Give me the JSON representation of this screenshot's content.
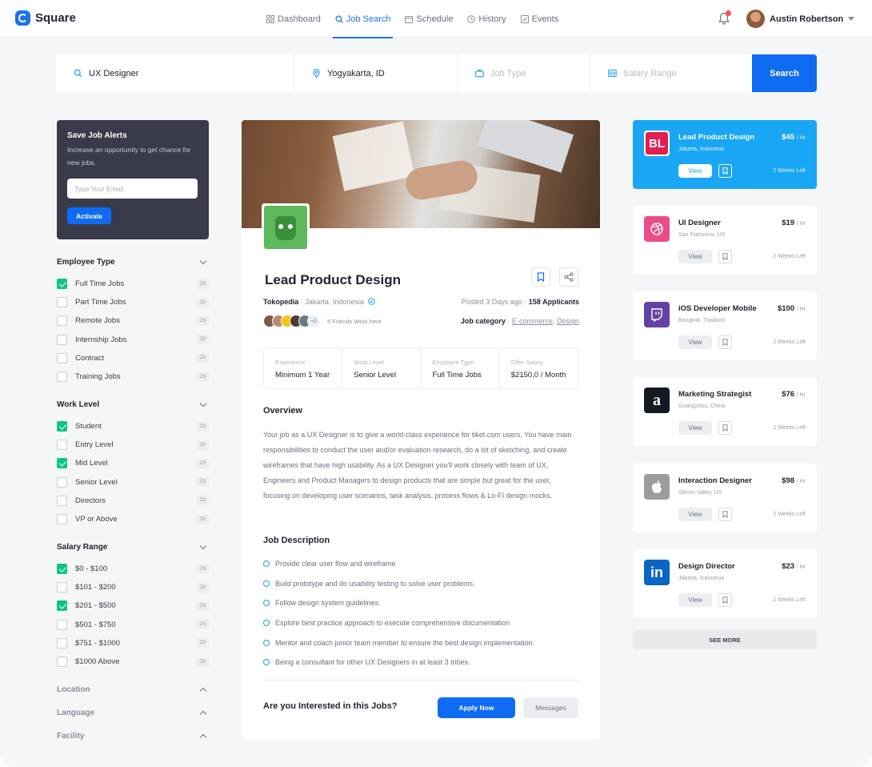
{
  "brand": {
    "name": "Square",
    "accent": "#0f6cf2"
  },
  "nav": {
    "items": [
      {
        "label": "Dashboard",
        "icon": "grid-icon"
      },
      {
        "label": "Job Search",
        "icon": "search-icon",
        "active": true
      },
      {
        "label": "Schedule",
        "icon": "calendar-icon"
      },
      {
        "label": "History",
        "icon": "clock-icon"
      },
      {
        "label": "Events",
        "icon": "checkbox-icon"
      }
    ],
    "user": {
      "name": "Austin Robertson"
    }
  },
  "search": {
    "keyword": "UX Designer",
    "location": "Yogyakarta, ID",
    "job_type_placeholder": "Job Type",
    "salary_placeholder": "Salary Range",
    "button": "Search"
  },
  "alerts": {
    "title": "Save Job Alerts",
    "desc": "Increase an opportunity to get chance for new jobs.",
    "email_placeholder": "Type Your Email",
    "button": "Activate"
  },
  "filters": {
    "employee_type": {
      "title": "Employee Type",
      "options": [
        {
          "label": "Full Time Jobs",
          "count": "23",
          "checked": true
        },
        {
          "label": "Part Time Jobs",
          "count": "23",
          "checked": false
        },
        {
          "label": "Remote Jobs",
          "count": "23",
          "checked": false
        },
        {
          "label": "Internship Jobs",
          "count": "23",
          "checked": false
        },
        {
          "label": "Contract",
          "count": "23",
          "checked": false
        },
        {
          "label": "Training Jobs",
          "count": "23",
          "checked": false
        }
      ]
    },
    "work_level": {
      "title": "Work Level",
      "options": [
        {
          "label": "Student",
          "count": "23",
          "checked": true
        },
        {
          "label": "Entry Level",
          "count": "23",
          "checked": false
        },
        {
          "label": "Mid Level",
          "count": "23",
          "checked": true
        },
        {
          "label": "Senior Level",
          "count": "23",
          "checked": false
        },
        {
          "label": "Directors",
          "count": "23",
          "checked": false
        },
        {
          "label": "VP or Above",
          "count": "23",
          "checked": false
        }
      ]
    },
    "salary_range": {
      "title": "Salary Range",
      "options": [
        {
          "label": "$0 - $100",
          "count": "23",
          "checked": true
        },
        {
          "label": "$101 - $200",
          "count": "23",
          "checked": false
        },
        {
          "label": "$201 - $500",
          "count": "23",
          "checked": true
        },
        {
          "label": "$501 - $750",
          "count": "23",
          "checked": false
        },
        {
          "label": "$751 - $1000",
          "count": "23",
          "checked": false
        },
        {
          "label": "$1000 Above",
          "count": "23",
          "checked": false
        }
      ]
    },
    "collapsed": [
      "Location",
      "Language",
      "Facility"
    ]
  },
  "job": {
    "title": "Lead Product Design",
    "company": "Tokopedia",
    "location": "Jakarta, Indonesia",
    "posted": "Posted 3 Days ago",
    "applicants": "158 Applicants",
    "friends_more": "+2",
    "friends_text": "5 Friends Work here",
    "category_label": "Job category",
    "categories": [
      "E-commerce",
      "Design"
    ],
    "stats": [
      {
        "label": "Experience",
        "value": "Minimum 1 Year"
      },
      {
        "label": "Work Level",
        "value": "Senior Level"
      },
      {
        "label": "Employee Type",
        "value": "Full Time Jobs"
      },
      {
        "label": "Offer Salary",
        "value": "$2150,0 / Month"
      }
    ],
    "overview_title": "Overview",
    "overview": "Your job as a UX Designer is to give a world-class experience for tiket.com users. You have main responsibilities to conduct the user and/or evaluation research, do a lot of sketching, and create wireframes that have high usability. As a UX Designer you'll work closely with team of UX, Engineers and Product Managers to design products that are simple but great for the user, focusing on developing user scenarios, task analysis, process flows & Lo-FI design mocks.",
    "description_title": "Job Description",
    "description": [
      "Provide clear user flow and wireframe",
      "Build prototype and do usability testing to solve user problems.",
      "Follow design system guidelines.",
      "Explore best practice approach to execute comprehensive documentation",
      "Mentor and coach junior team member to ensure the best design implementation.",
      "Being a consultant for other UX Designers in at least 3 tribes."
    ],
    "interest": "Are you Interested in this Jobs?",
    "apply": "Apply Now",
    "messages": "Messages"
  },
  "job_list": [
    {
      "title": "Lead Product Design",
      "location": "Jakarta, Indonesia",
      "pay": "$45",
      "unit": "/ Hr",
      "view": "View",
      "left": "2 Weeks Left",
      "logo": "BL",
      "logo_color": "#e31e52",
      "featured": true
    },
    {
      "title": "UI Designer",
      "location": "San Fransisco, US",
      "pay": "$19",
      "unit": "/ Hr",
      "view": "View",
      "left": "2 Weeks Left",
      "logo": "dribbble-icon",
      "logo_color": "#ea4c89"
    },
    {
      "title": "iOS Developer Mobile",
      "location": "Bangkok, Thailand",
      "pay": "$100",
      "unit": "/ Hr",
      "view": "View",
      "left": "2 Weeks Left",
      "logo": "twitch-icon",
      "logo_color": "#6441a5"
    },
    {
      "title": "Marketing Strategist",
      "location": "Guangzhou, China",
      "pay": "$76",
      "unit": "/ Hr",
      "view": "View",
      "left": "2 Weeks Left",
      "logo": "a",
      "logo_color": "#131a22"
    },
    {
      "title": "Interaction Designer",
      "location": "Silicon Valley, US",
      "pay": "$98",
      "unit": "/ Hr",
      "view": "View",
      "left": "2 Weeks Left",
      "logo": "apple-icon",
      "logo_color": "#8e8e93"
    },
    {
      "title": "Design Director",
      "location": "Jakarta, Indonesia",
      "pay": "$23",
      "unit": "/ Hr",
      "view": "View",
      "left": "2 Weeks Left",
      "logo": "in",
      "logo_color": "#0a66c2"
    }
  ],
  "see_more": "SEE MORE"
}
